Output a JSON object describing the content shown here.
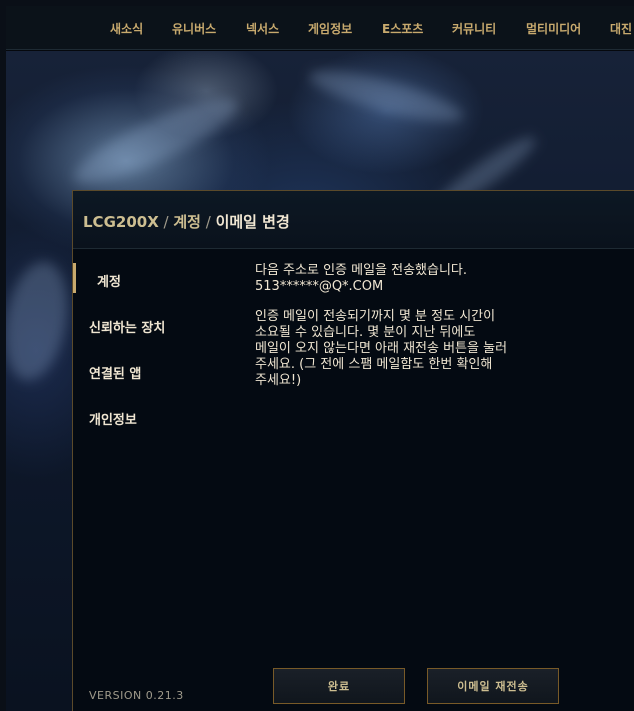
{
  "nav": {
    "items": [
      {
        "label": "새소식"
      },
      {
        "label": "유니버스"
      },
      {
        "label": "넥서스"
      },
      {
        "label": "게임정보"
      },
      {
        "label": "E스포츠"
      },
      {
        "label": "커뮤니티"
      },
      {
        "label": "멀티미디어"
      },
      {
        "label": "대진"
      }
    ]
  },
  "breadcrumb": {
    "user": "LCG200X",
    "sep1": " / ",
    "account": "계정",
    "sep2": " / ",
    "current": "이메일 변경"
  },
  "sidebar": {
    "items": [
      {
        "label": "계정",
        "active": true
      },
      {
        "label": "신뢰하는 장치",
        "active": false
      },
      {
        "label": "연결된 앱",
        "active": false
      },
      {
        "label": "개인정보",
        "active": false
      }
    ],
    "version": "VERSION 0.21.3"
  },
  "content": {
    "line1": "다음 주소로 인증 메일을 전송했습니다.",
    "email": "513******@Q*.COM",
    "notice_lines": [
      "인증 메일이 전송되기까지 몇 분 정도 시간이",
      "소요될 수 있습니다. 몇 분이 지난 뒤에도",
      "메일이 오지 않는다면 아래 재전송 버튼을 눌러",
      "주세요. (그 전에 스팸 메일함도 한번 확인해",
      "주세요!)"
    ]
  },
  "buttons": {
    "done": "완료",
    "resend": "이메일 재전송"
  },
  "colors": {
    "gold": "#c8aa6e",
    "text": "#f0e6d2",
    "border": "#785a28"
  }
}
